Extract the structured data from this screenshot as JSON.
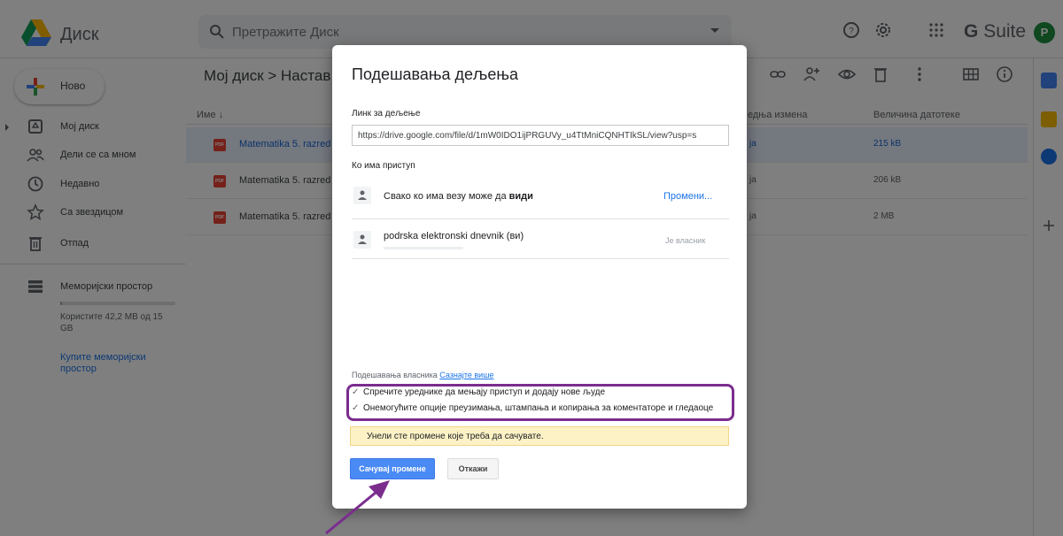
{
  "app": {
    "title": "Диск",
    "gsuite_prefix": "G",
    "gsuite_text": "Suite",
    "avatar_letter": "P"
  },
  "search": {
    "placeholder": "Претражите Диск"
  },
  "sidebar": {
    "new_label": "Ново",
    "items": [
      {
        "label": "Мој диск"
      },
      {
        "label": "Дели се са мном"
      },
      {
        "label": "Недавно"
      },
      {
        "label": "Са звездицом"
      },
      {
        "label": "Отпад"
      },
      {
        "label": "Меморијски простор"
      }
    ],
    "storage_text": "Користите 42,2 MB од 15 GB",
    "storage_fraction": 0.003,
    "buy_storage": "Купите меморијски простор"
  },
  "breadcrumb": "Мој диск  >  Настав",
  "table": {
    "col_name": "Име  ↓",
    "col_modified": "едња измена",
    "col_size": "Величина датотеке",
    "rows": [
      {
        "name": "Matematika 5. razred",
        "owner": "ја",
        "size": "215 kB"
      },
      {
        "name": "Matematika 5. razred",
        "owner": "ја",
        "size": "206 kB"
      },
      {
        "name": "Matematika 5. razred",
        "owner": "ја",
        "size": "2 MB"
      }
    ]
  },
  "dialog": {
    "title": "Подешавања дељења",
    "link_label": "Линк за дељење",
    "link_value": "https://drive.google.com/file/d/1mW0IDO1ijPRGUVy_u4TtMniCQNHTIkSL/view?usp=s",
    "access_label": "Ко има приступ",
    "anyone_text": "Свако ко има везу може да ",
    "anyone_bold": "види",
    "change_link": "Промени...",
    "owner_name": "podrska elektronski dnevnik (ви)",
    "owner_role": "Је власник",
    "owner_settings": "Подешавања власника",
    "learn_more": "Сазнајте више",
    "check1": "Спречите уреднике да мењају приступ и додају нове људе",
    "check2": "Онемогућите опције преузимања, штампања и копирања за коментаторе и гледаоце",
    "check_mark": "✓",
    "warning": "Унели сте промене које треба да сачувате.",
    "save": "Сачувај промене",
    "cancel": "Откажи"
  },
  "colors": {
    "accent": "#1a73e8",
    "annotation": "#7b2d8e",
    "save": "#4a8af4",
    "warning_bg": "#fdf2c6"
  }
}
